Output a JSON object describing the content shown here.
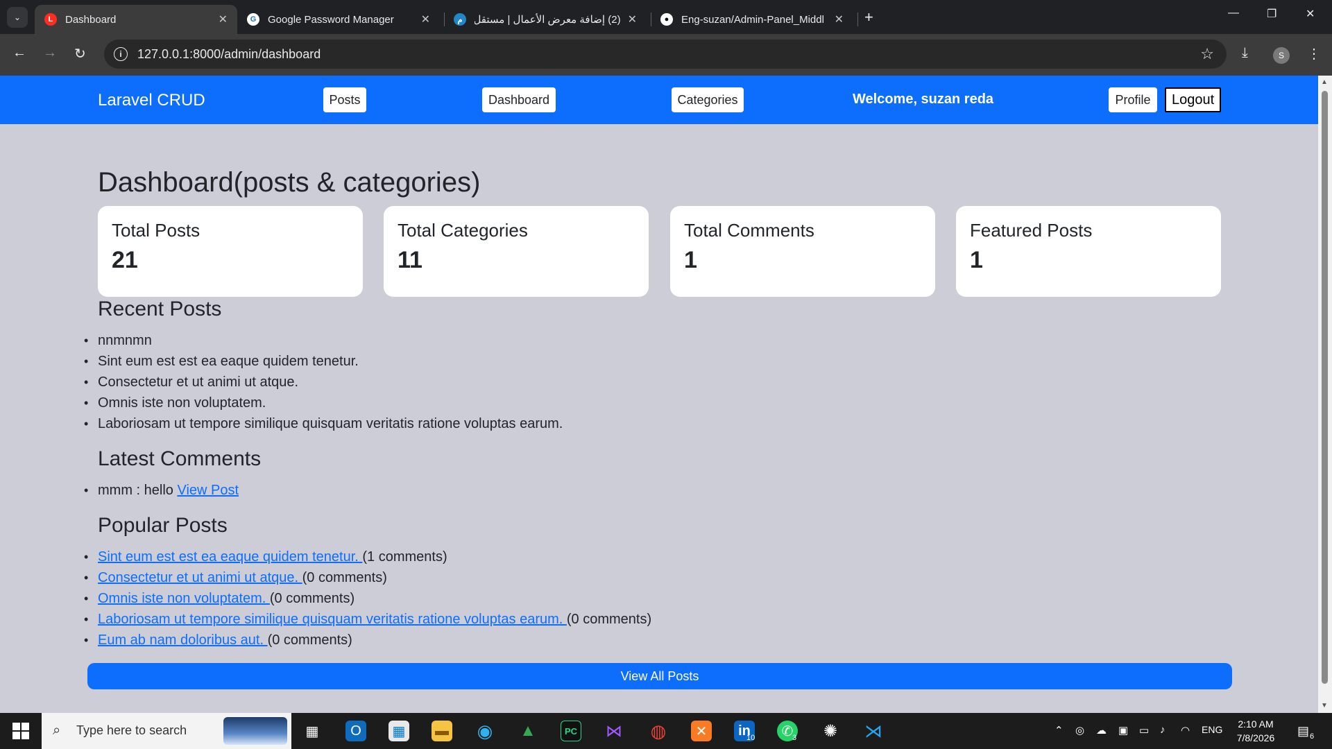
{
  "browser": {
    "tabs": [
      {
        "title": "Dashboard",
        "favicon": "laravel-icon",
        "active": true
      },
      {
        "title": "Google Password Manager",
        "favicon": "google-password-icon",
        "active": false
      },
      {
        "title": "(2) إضافة معرض الأعمال | مستقل",
        "favicon": "mostaql-icon",
        "active": false
      },
      {
        "title": "Eng-suzan/Admin-Panel_Middl",
        "favicon": "github-icon",
        "active": false
      }
    ],
    "url": "127.0.0.1:8000/admin/dashboard",
    "profile_initial": "S"
  },
  "navbar": {
    "brand": "Laravel CRUD",
    "links": [
      "Posts",
      "Dashboard",
      "Categories"
    ],
    "welcome": "Welcome, suzan reda",
    "profile": "Profile",
    "logout": "Logout"
  },
  "page_title": "Dashboard(posts & categories)",
  "stats": [
    {
      "label": "Total Posts",
      "value": "21"
    },
    {
      "label": "Total Categories",
      "value": "11"
    },
    {
      "label": "Total Comments",
      "value": "1"
    },
    {
      "label": "Featured Posts",
      "value": "1"
    }
  ],
  "recent_posts": {
    "heading": "Recent Posts",
    "items": [
      "nnmnmn",
      "Sint eum est est ea eaque quidem tenetur.",
      "Consectetur et ut animi ut atque.",
      "Omnis iste non voluptatem.",
      "Laboriosam ut tempore similique quisquam veritatis ratione voluptas earum."
    ]
  },
  "latest_comments": {
    "heading": "Latest Comments",
    "items": [
      {
        "text": "mmm : hello",
        "link": "View Post"
      }
    ]
  },
  "popular_posts": {
    "heading": "Popular Posts",
    "items": [
      {
        "title": "Sint eum est est ea eaque quidem tenetur. ",
        "count": "(1 comments)"
      },
      {
        "title": "Consectetur et ut animi ut atque. ",
        "count": "(0 comments)"
      },
      {
        "title": "Omnis iste non voluptatem. ",
        "count": "(0 comments)"
      },
      {
        "title": "Laboriosam ut tempore similique quisquam veritatis ratione voluptas earum. ",
        "count": "(0 comments)"
      },
      {
        "title": "Eum ab nam doloribus aut. ",
        "count": "(0 comments)"
      }
    ]
  },
  "view_all": "View All Posts",
  "taskbar": {
    "search_placeholder": "Type here to search",
    "lang": "ENG",
    "time": "2:10 AM",
    "date": "7/8/2026",
    "notification_count": "6",
    "linkedin_badge": "10",
    "whatsapp_badge": "3"
  },
  "colors": {
    "primary": "#0d6efd",
    "page_bg": "#cdcdd8"
  }
}
